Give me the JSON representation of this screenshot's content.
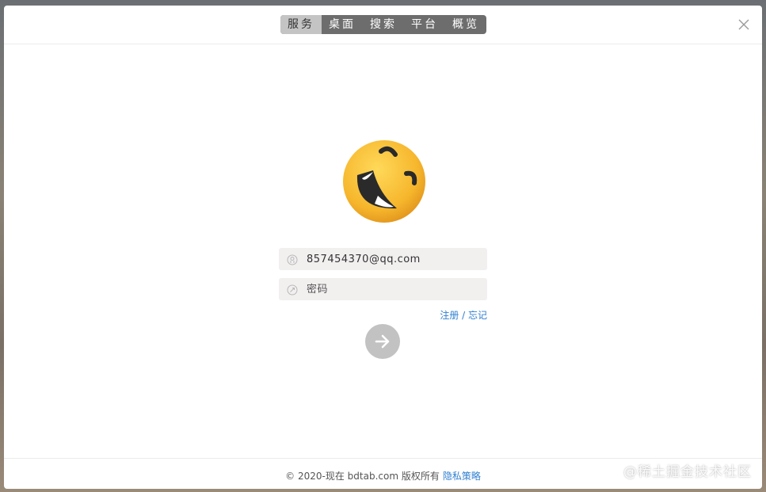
{
  "tabs": [
    {
      "label": "服务",
      "active": true
    },
    {
      "label": "桌面",
      "active": false
    },
    {
      "label": "搜索",
      "active": false
    },
    {
      "label": "平台",
      "active": false
    },
    {
      "label": "概览",
      "active": false
    }
  ],
  "close_icon": "close-icon",
  "avatar_icon": "laughing-emoji-icon",
  "login": {
    "username_value": "857454370@qq.com",
    "username_icon": "user-icon",
    "password_placeholder": "密码",
    "password_icon": "lock-icon",
    "links_label": "注册 / 忘记",
    "submit_icon": "arrow-right-icon"
  },
  "footer": {
    "copyright": "© 2020-现在 bdtab.com 版权所有",
    "privacy_label": "隐私策略"
  },
  "watermark": "@稀土掘金技术社区",
  "colors": {
    "link": "#2f7fd1",
    "tab_bg": "#6d6d6d",
    "tab_active_bg": "#c4c4c4",
    "field_bg": "#f2efef",
    "submit_bg": "#c2c2c2"
  }
}
